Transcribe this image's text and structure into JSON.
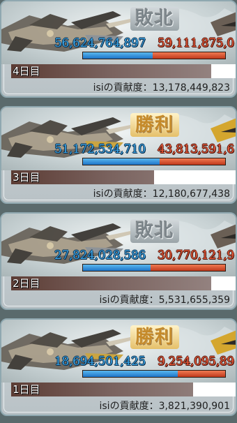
{
  "cards": [
    {
      "result": "敗北",
      "result_type": "lose",
      "our_score": "56,624,764,897",
      "their_score": "59,111,875,0",
      "our_ratio": 0.489,
      "day": "4日目",
      "day_progress": 0.88,
      "contrib_label": "isiの貢献度：13,178,449,823"
    },
    {
      "result": "勝利",
      "result_type": "win",
      "our_score": "51,172,534,710",
      "their_score": "43,813,591,6",
      "our_ratio": 0.539,
      "day": "3日目",
      "day_progress": 0.63,
      "contrib_label": "isiの貢献度：12,180,677,438"
    },
    {
      "result": "敗北",
      "result_type": "lose",
      "our_score": "27,824,028,586",
      "their_score": "30,770,121,9",
      "our_ratio": 0.475,
      "day": "2日目",
      "day_progress": 0.88,
      "contrib_label": "isiの貢献度：5,531,655,359"
    },
    {
      "result": "勝利",
      "result_type": "win",
      "our_score": "18,694,501,425",
      "their_score": "9,254,095,89",
      "our_ratio": 0.669,
      "day": "1日目",
      "day_progress": 0.8,
      "contrib_label": "isiの貢献度：3,821,390,901"
    }
  ],
  "colors": {
    "our_blue": "#3aa2e3",
    "their_red": "#e85a3a",
    "win_gold": "#c58a2a",
    "lose_gray": "#7c858a"
  }
}
